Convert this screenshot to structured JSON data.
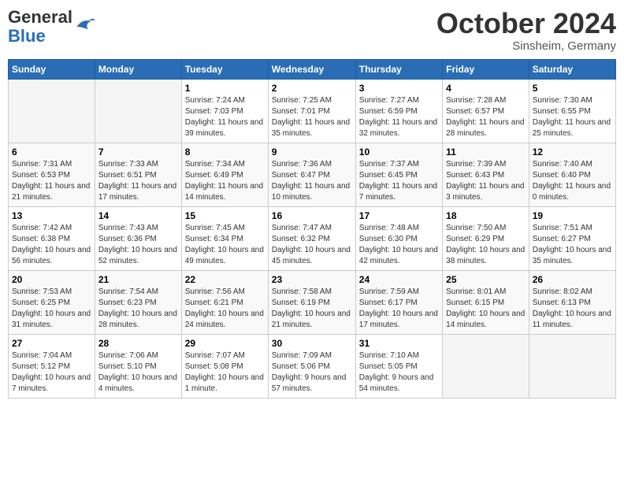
{
  "header": {
    "logo_line1": "General",
    "logo_line2": "Blue",
    "month": "October 2024",
    "location": "Sinsheim, Germany"
  },
  "weekdays": [
    "Sunday",
    "Monday",
    "Tuesday",
    "Wednesday",
    "Thursday",
    "Friday",
    "Saturday"
  ],
  "weeks": [
    [
      {
        "day": "",
        "sunrise": "",
        "sunset": "",
        "daylight": ""
      },
      {
        "day": "",
        "sunrise": "",
        "sunset": "",
        "daylight": ""
      },
      {
        "day": "1",
        "sunrise": "Sunrise: 7:24 AM",
        "sunset": "Sunset: 7:03 PM",
        "daylight": "Daylight: 11 hours and 39 minutes."
      },
      {
        "day": "2",
        "sunrise": "Sunrise: 7:25 AM",
        "sunset": "Sunset: 7:01 PM",
        "daylight": "Daylight: 11 hours and 35 minutes."
      },
      {
        "day": "3",
        "sunrise": "Sunrise: 7:27 AM",
        "sunset": "Sunset: 6:59 PM",
        "daylight": "Daylight: 11 hours and 32 minutes."
      },
      {
        "day": "4",
        "sunrise": "Sunrise: 7:28 AM",
        "sunset": "Sunset: 6:57 PM",
        "daylight": "Daylight: 11 hours and 28 minutes."
      },
      {
        "day": "5",
        "sunrise": "Sunrise: 7:30 AM",
        "sunset": "Sunset: 6:55 PM",
        "daylight": "Daylight: 11 hours and 25 minutes."
      }
    ],
    [
      {
        "day": "6",
        "sunrise": "Sunrise: 7:31 AM",
        "sunset": "Sunset: 6:53 PM",
        "daylight": "Daylight: 11 hours and 21 minutes."
      },
      {
        "day": "7",
        "sunrise": "Sunrise: 7:33 AM",
        "sunset": "Sunset: 6:51 PM",
        "daylight": "Daylight: 11 hours and 17 minutes."
      },
      {
        "day": "8",
        "sunrise": "Sunrise: 7:34 AM",
        "sunset": "Sunset: 6:49 PM",
        "daylight": "Daylight: 11 hours and 14 minutes."
      },
      {
        "day": "9",
        "sunrise": "Sunrise: 7:36 AM",
        "sunset": "Sunset: 6:47 PM",
        "daylight": "Daylight: 11 hours and 10 minutes."
      },
      {
        "day": "10",
        "sunrise": "Sunrise: 7:37 AM",
        "sunset": "Sunset: 6:45 PM",
        "daylight": "Daylight: 11 hours and 7 minutes."
      },
      {
        "day": "11",
        "sunrise": "Sunrise: 7:39 AM",
        "sunset": "Sunset: 6:43 PM",
        "daylight": "Daylight: 11 hours and 3 minutes."
      },
      {
        "day": "12",
        "sunrise": "Sunrise: 7:40 AM",
        "sunset": "Sunset: 6:40 PM",
        "daylight": "Daylight: 11 hours and 0 minutes."
      }
    ],
    [
      {
        "day": "13",
        "sunrise": "Sunrise: 7:42 AM",
        "sunset": "Sunset: 6:38 PM",
        "daylight": "Daylight: 10 hours and 56 minutes."
      },
      {
        "day": "14",
        "sunrise": "Sunrise: 7:43 AM",
        "sunset": "Sunset: 6:36 PM",
        "daylight": "Daylight: 10 hours and 52 minutes."
      },
      {
        "day": "15",
        "sunrise": "Sunrise: 7:45 AM",
        "sunset": "Sunset: 6:34 PM",
        "daylight": "Daylight: 10 hours and 49 minutes."
      },
      {
        "day": "16",
        "sunrise": "Sunrise: 7:47 AM",
        "sunset": "Sunset: 6:32 PM",
        "daylight": "Daylight: 10 hours and 45 minutes."
      },
      {
        "day": "17",
        "sunrise": "Sunrise: 7:48 AM",
        "sunset": "Sunset: 6:30 PM",
        "daylight": "Daylight: 10 hours and 42 minutes."
      },
      {
        "day": "18",
        "sunrise": "Sunrise: 7:50 AM",
        "sunset": "Sunset: 6:29 PM",
        "daylight": "Daylight: 10 hours and 38 minutes."
      },
      {
        "day": "19",
        "sunrise": "Sunrise: 7:51 AM",
        "sunset": "Sunset: 6:27 PM",
        "daylight": "Daylight: 10 hours and 35 minutes."
      }
    ],
    [
      {
        "day": "20",
        "sunrise": "Sunrise: 7:53 AM",
        "sunset": "Sunset: 6:25 PM",
        "daylight": "Daylight: 10 hours and 31 minutes."
      },
      {
        "day": "21",
        "sunrise": "Sunrise: 7:54 AM",
        "sunset": "Sunset: 6:23 PM",
        "daylight": "Daylight: 10 hours and 28 minutes."
      },
      {
        "day": "22",
        "sunrise": "Sunrise: 7:56 AM",
        "sunset": "Sunset: 6:21 PM",
        "daylight": "Daylight: 10 hours and 24 minutes."
      },
      {
        "day": "23",
        "sunrise": "Sunrise: 7:58 AM",
        "sunset": "Sunset: 6:19 PM",
        "daylight": "Daylight: 10 hours and 21 minutes."
      },
      {
        "day": "24",
        "sunrise": "Sunrise: 7:59 AM",
        "sunset": "Sunset: 6:17 PM",
        "daylight": "Daylight: 10 hours and 17 minutes."
      },
      {
        "day": "25",
        "sunrise": "Sunrise: 8:01 AM",
        "sunset": "Sunset: 6:15 PM",
        "daylight": "Daylight: 10 hours and 14 minutes."
      },
      {
        "day": "26",
        "sunrise": "Sunrise: 8:02 AM",
        "sunset": "Sunset: 6:13 PM",
        "daylight": "Daylight: 10 hours and 11 minutes."
      }
    ],
    [
      {
        "day": "27",
        "sunrise": "Sunrise: 7:04 AM",
        "sunset": "Sunset: 5:12 PM",
        "daylight": "Daylight: 10 hours and 7 minutes."
      },
      {
        "day": "28",
        "sunrise": "Sunrise: 7:06 AM",
        "sunset": "Sunset: 5:10 PM",
        "daylight": "Daylight: 10 hours and 4 minutes."
      },
      {
        "day": "29",
        "sunrise": "Sunrise: 7:07 AM",
        "sunset": "Sunset: 5:08 PM",
        "daylight": "Daylight: 10 hours and 1 minute."
      },
      {
        "day": "30",
        "sunrise": "Sunrise: 7:09 AM",
        "sunset": "Sunset: 5:06 PM",
        "daylight": "Daylight: 9 hours and 57 minutes."
      },
      {
        "day": "31",
        "sunrise": "Sunrise: 7:10 AM",
        "sunset": "Sunset: 5:05 PM",
        "daylight": "Daylight: 9 hours and 54 minutes."
      },
      {
        "day": "",
        "sunrise": "",
        "sunset": "",
        "daylight": ""
      },
      {
        "day": "",
        "sunrise": "",
        "sunset": "",
        "daylight": ""
      }
    ]
  ]
}
